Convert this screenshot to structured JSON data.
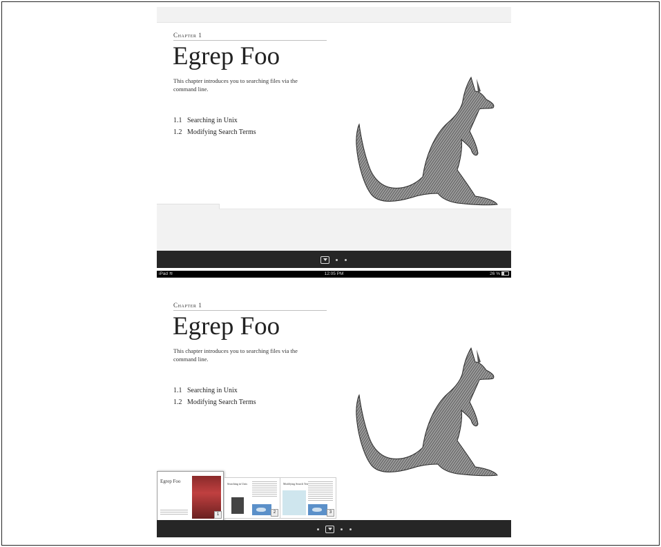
{
  "book": {
    "chapter_label": "Chapter 1",
    "chapter_title": "Egrep Foo",
    "intro": "This chapter introduces you to searching files via the command line.",
    "toc": [
      {
        "num": "1.1",
        "title": "Searching in Unix"
      },
      {
        "num": "1.2",
        "title": "Modifying Search Terms"
      }
    ]
  },
  "status_bar": {
    "device": "iPad",
    "time": "12:05 PM",
    "battery": "26 %"
  },
  "thumbnails": [
    {
      "title": "Egrep Foo",
      "page": "1"
    },
    {
      "title": "Searching in Unix",
      "page": "2"
    },
    {
      "title": "Modifying Search Terms",
      "page": "3"
    }
  ],
  "colors": {
    "toolbar": "#262626",
    "band": "#f2f2f2"
  }
}
